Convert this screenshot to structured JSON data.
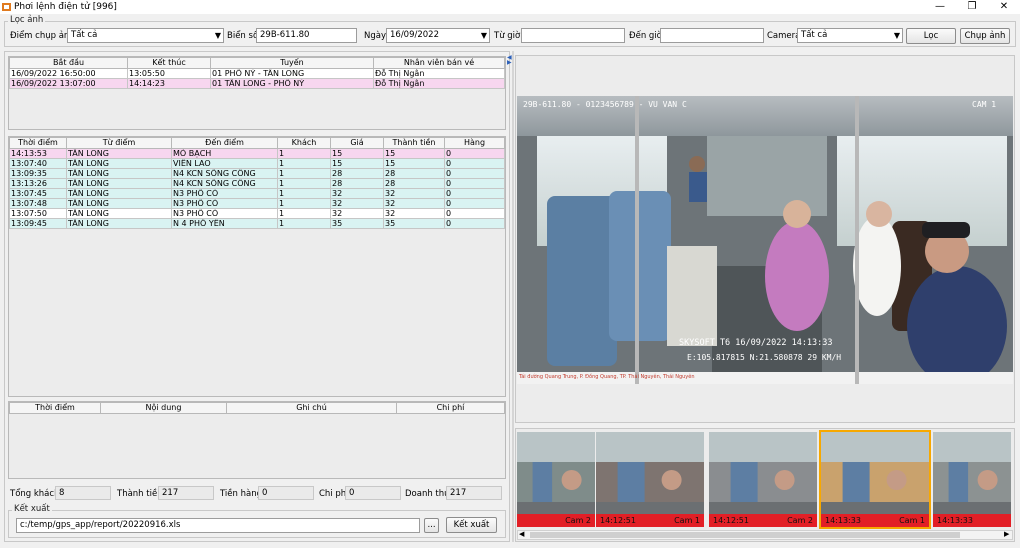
{
  "window": {
    "title": "Phơi lệnh điện tử [996]",
    "controls": [
      "—",
      "❐",
      "✕"
    ]
  },
  "filter": {
    "group_title": "Lọc ảnh",
    "capture_point_label": "Điểm chụp ảnh",
    "capture_point_value": "Tất cả",
    "plate_label": "Biển số",
    "plate_value": "29B-611.80",
    "date_label": "Ngày",
    "date_value": "16/09/2022",
    "from_time_label": "Từ giờ",
    "from_time_value": "",
    "to_time_label": "Đến giờ",
    "to_time_value": "",
    "camera_label": "Camera",
    "camera_value": "Tất cả",
    "filter_button": "Lọc",
    "capture_button": "Chụp ảnh"
  },
  "trips": {
    "columns": [
      "Bắt đầu",
      "Kết thúc",
      "Tuyến",
      "Nhân viên bán vé"
    ],
    "rows": [
      {
        "start": "16/09/2022 16:50:00",
        "end": "13:05:50",
        "route": "01 PHỐ NỶ - TÂN LONG",
        "staff": "Đỗ Thị Ngân",
        "style": "white"
      },
      {
        "start": "16/09/2022 13:07:00",
        "end": "14:14:23",
        "route": "01 TÂN LONG - PHỐ NỶ",
        "staff": "Đỗ Thị Ngân",
        "style": "pink"
      }
    ]
  },
  "tickets": {
    "columns": [
      "Thời điểm",
      "Từ điểm",
      "Đến điểm",
      "Khách",
      "Giá",
      "Thành tiền",
      "Hàng"
    ],
    "rows": [
      {
        "time": "14:13:53",
        "from": "TÂN LONG",
        "to": "MỎ BẠCH",
        "pax": "1",
        "price": "15",
        "total": "15",
        "goods": "0",
        "style": "pink"
      },
      {
        "time": "13:07:40",
        "from": "TÂN LONG",
        "to": "VIÊN LAO",
        "pax": "1",
        "price": "15",
        "total": "15",
        "goods": "0",
        "style": "cyan"
      },
      {
        "time": "13:09:35",
        "from": "TÂN LONG",
        "to": "N4 KCN SÔNG CÔNG",
        "pax": "1",
        "price": "28",
        "total": "28",
        "goods": "0",
        "style": "cyan"
      },
      {
        "time": "13:13:26",
        "from": "TÂN LONG",
        "to": "N4 KCN SÔNG CÔNG",
        "pax": "1",
        "price": "28",
        "total": "28",
        "goods": "0",
        "style": "cyan"
      },
      {
        "time": "13:07:45",
        "from": "TÂN LONG",
        "to": "N3 PHỐ CÒ",
        "pax": "1",
        "price": "32",
        "total": "32",
        "goods": "0",
        "style": "cyan"
      },
      {
        "time": "13:07:48",
        "from": "TÂN LONG",
        "to": "N3 PHỐ CÒ",
        "pax": "1",
        "price": "32",
        "total": "32",
        "goods": "0",
        "style": "cyan"
      },
      {
        "time": "13:07:50",
        "from": "TÂN LONG",
        "to": "N3 PHỐ CÒ",
        "pax": "1",
        "price": "32",
        "total": "32",
        "goods": "0",
        "style": "white"
      },
      {
        "time": "13:09:45",
        "from": "TÂN LONG",
        "to": "N 4 PHỐ YÊN",
        "pax": "1",
        "price": "35",
        "total": "35",
        "goods": "0",
        "style": "cyan"
      }
    ]
  },
  "costs": {
    "columns": [
      "Thời điểm",
      "Nội dung",
      "Ghi chú",
      "Chi phí"
    ]
  },
  "summary": {
    "total_pax_label": "Tổng khách",
    "total_pax": "8",
    "amount_label": "Thành tiền",
    "amount": "217",
    "goods_label": "Tiền hàng",
    "goods": "0",
    "cost_label": "Chi phí",
    "cost": "0",
    "revenue_label": "Doanh thu",
    "revenue": "217"
  },
  "export": {
    "group_title": "Kết xuất",
    "path": "c:/temp/gps_app/report/20220916.xls",
    "browse_button": "...",
    "export_button": "Kết xuất"
  },
  "video": {
    "top_overlay": "29B-611.80 - 0123456789 - VU VAN C",
    "cam_overlay": "CAM 1",
    "bottom_overlay_1": "SKYSOFT T6 16/09/2022 14:13:33",
    "bottom_overlay_2": "E:105.817815   N:21.580878   29 KM/H",
    "footer_text": "Tái đường Quang Trung, P. Đồng Quang, TP. Thái Nguyên, Thái Nguyên"
  },
  "thumbnails": [
    {
      "time": "",
      "camera": "Cam 2",
      "selected": false
    },
    {
      "time": "14:12:51",
      "camera": "Cam 1",
      "selected": false
    },
    {
      "time": "14:12:51",
      "camera": "Cam 2",
      "selected": false
    },
    {
      "time": "14:13:33",
      "camera": "Cam 1",
      "selected": true
    },
    {
      "time": "14:13:33",
      "camera": "",
      "selected": false
    }
  ],
  "colors": {
    "row_pink": "#f7d6ef",
    "row_cyan": "#d9f3f2",
    "caption_red": "#e21f26",
    "selected_border": "#f7a800"
  }
}
